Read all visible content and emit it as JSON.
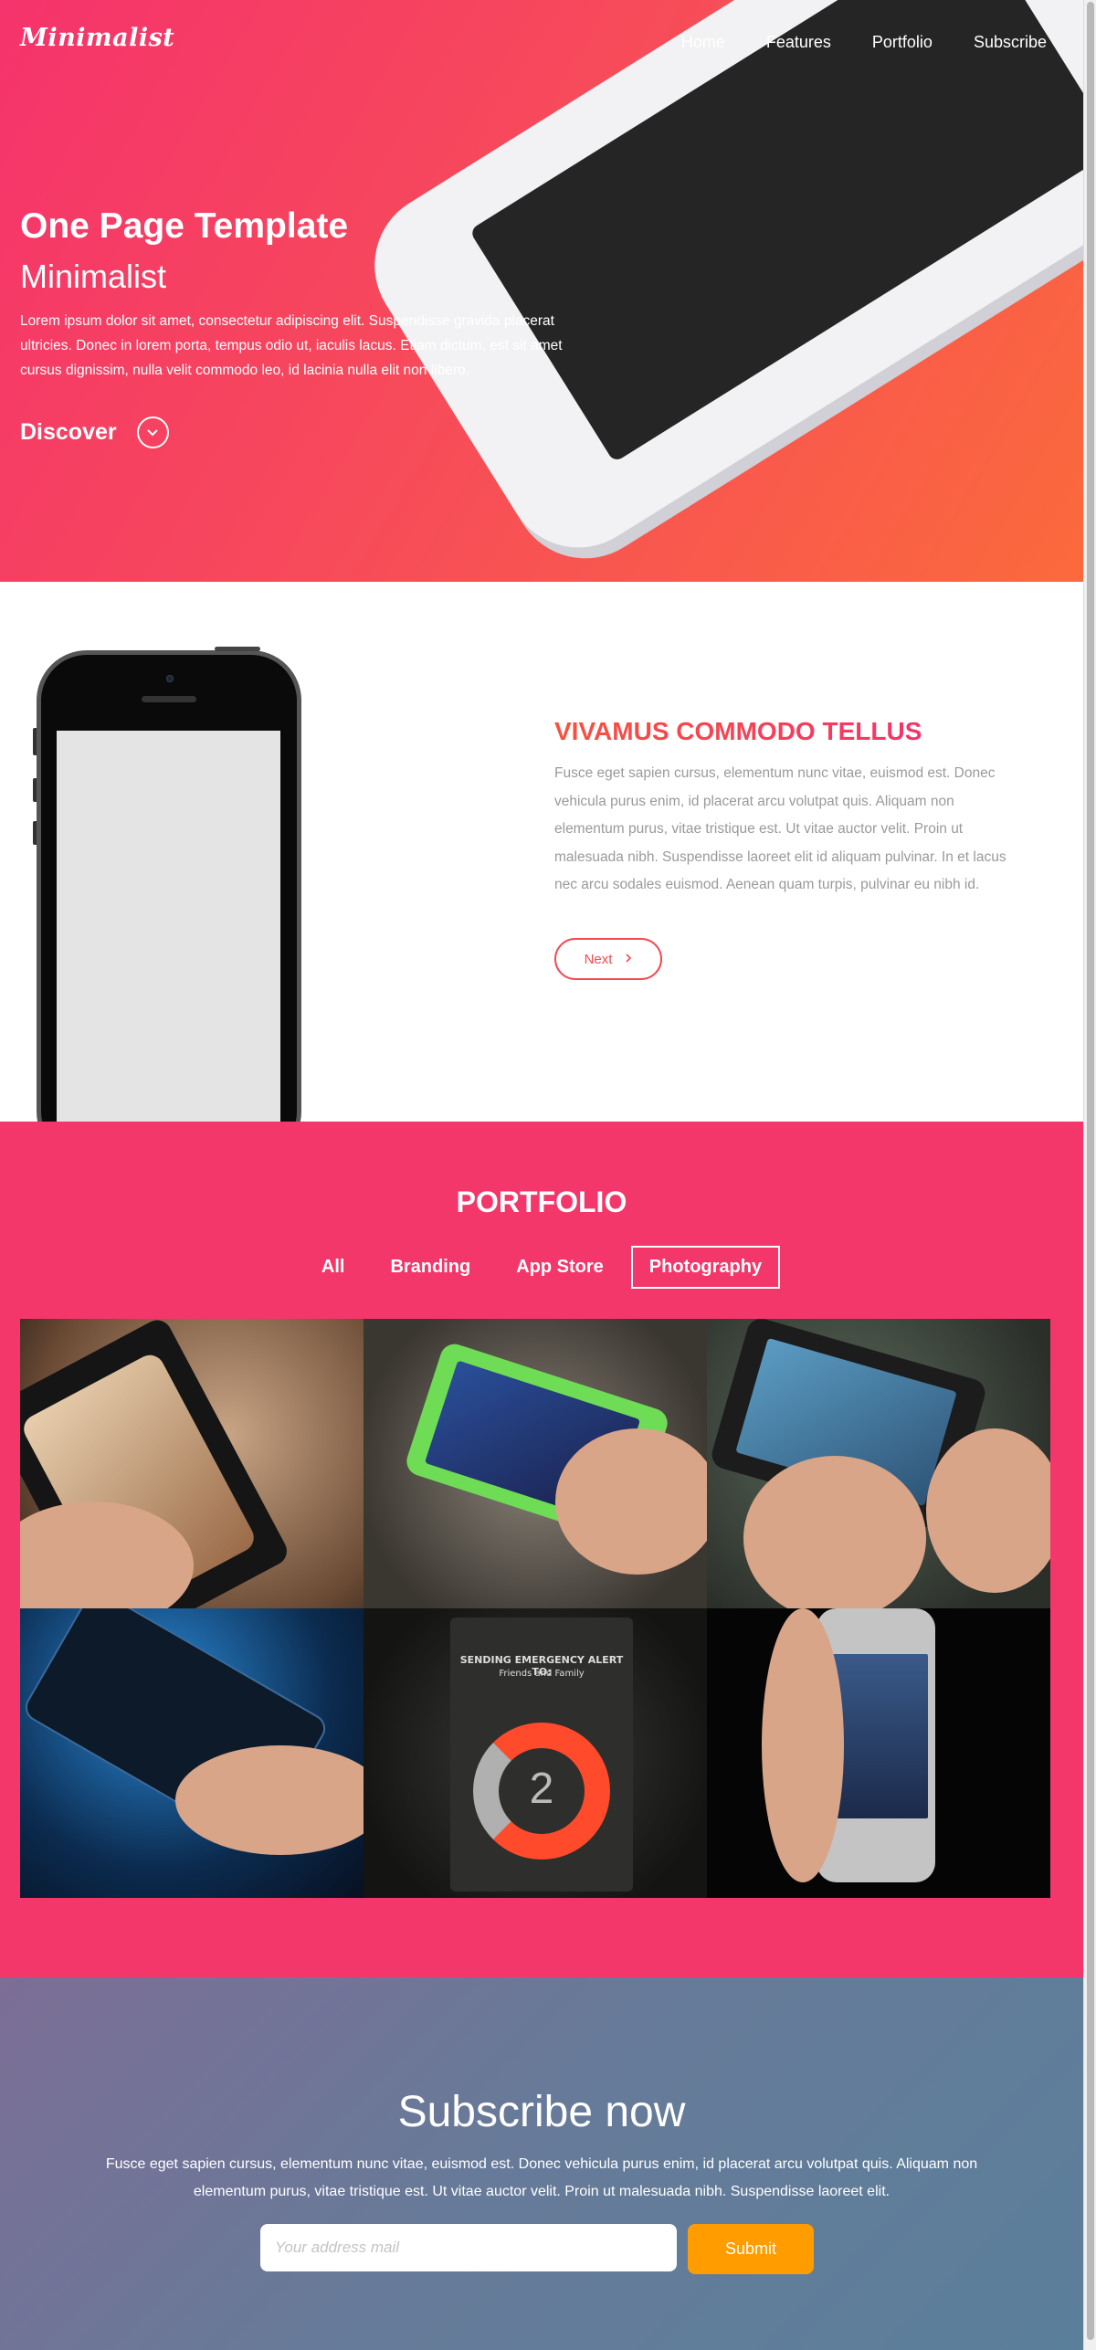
{
  "header": {
    "logo": "Minimalist",
    "nav": [
      "Home",
      "Features",
      "Portfolio",
      "Subscribe"
    ]
  },
  "hero": {
    "title": "One Page Template",
    "subtitle": "Minimalist",
    "text": "Lorem ipsum dolor sit amet, consectetur adipiscing elit. Suspendisse gravida placerat ultricies. Donec in lorem porta, tempus odio ut, iaculis lacus. Etiam dictum, est sit amet cursus dignissim, nulla velit commodo leo, id lacinia nulla elit non libero.",
    "discover_label": "Discover",
    "discover_icon": "chevron-down-icon"
  },
  "feature": {
    "title": "VIVAMUS COMMODO TELLUS",
    "text": "Fusce eget sapien cursus, elementum nunc vitae, euismod est. Donec vehicula purus enim, id placerat arcu volutpat quis. Aliquam non elementum purus, vitae tristique est. Ut vitae auctor velit. Proin ut malesuada nibh. Suspendisse laoreet elit id aliquam pulvinar. In et lacus nec arcu sodales euismod. Aenean quam turpis, pulvinar eu nibh id.",
    "next_label": "Next",
    "next_icon": "chevron-right-icon"
  },
  "portfolio": {
    "title": "PORTFOLIO",
    "filters": [
      "All",
      "Branding",
      "App Store",
      "Photography"
    ],
    "active_filter": "Photography",
    "emergency_text": "SENDING EMERGENCY ALERT TO:",
    "emergency_sub": "Friends and Family",
    "emergency_count": "2"
  },
  "subscribe": {
    "title": "Subscribe now",
    "text": "Fusce eget sapien cursus, elementum nunc vitae, euismod est. Donec vehicula purus enim, id placerat arcu volutpat quis. Aliquam non elementum purus, vitae tristique est. Ut vitae auctor velit. Proin ut malesuada nibh. Suspendisse laoreet elit.",
    "placeholder": "Your address mail",
    "button": "Submit"
  },
  "colors": {
    "pink": "#f4376b",
    "orange": "#fb6a3c",
    "submit": "#ff9c00"
  }
}
